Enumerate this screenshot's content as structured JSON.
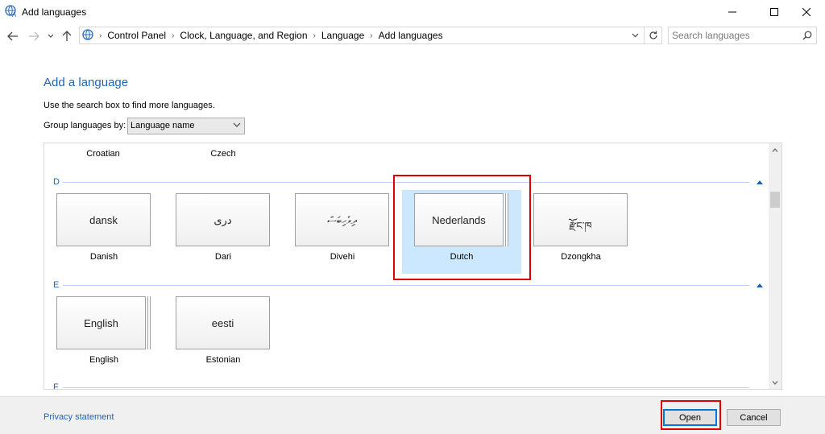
{
  "window": {
    "title": "Add languages",
    "icon": "language-globe-icon"
  },
  "nav": {
    "back": "back-arrow-icon",
    "forward": "forward-arrow-icon",
    "recent": "chevron-down-icon",
    "up": "up-arrow-icon"
  },
  "breadcrumb": [
    "Control Panel",
    "Clock, Language, and Region",
    "Language",
    "Add languages"
  ],
  "search": {
    "placeholder": "Search languages"
  },
  "content": {
    "heading": "Add a language",
    "hint": "Use the search box to find more languages.",
    "group_label": "Group languages by:",
    "group_value": "Language name"
  },
  "languages": {
    "partial_row": [
      "Croatian",
      "Czech"
    ],
    "sections": [
      {
        "letter": "D",
        "items": [
          {
            "native": "dansk",
            "name": "Danish",
            "multi": false
          },
          {
            "native": "دری",
            "name": "Dari",
            "multi": false
          },
          {
            "native": "ދިވެހިބަސް",
            "name": "Divehi",
            "multi": false
          },
          {
            "native": "Nederlands",
            "name": "Dutch",
            "multi": true,
            "selected": true
          },
          {
            "native": "རྫོང་ཁ",
            "name": "Dzongkha",
            "multi": false
          }
        ]
      },
      {
        "letter": "E",
        "items": [
          {
            "native": "English",
            "name": "English",
            "multi": true
          },
          {
            "native": "eesti",
            "name": "Estonian",
            "multi": false
          }
        ]
      },
      {
        "letter": "F",
        "items": []
      }
    ]
  },
  "footer": {
    "privacy": "Privacy statement",
    "open": "Open",
    "cancel": "Cancel"
  },
  "colors": {
    "accent": "#1e64b4",
    "selection": "#cce8ff",
    "highlight": "#e00000"
  }
}
